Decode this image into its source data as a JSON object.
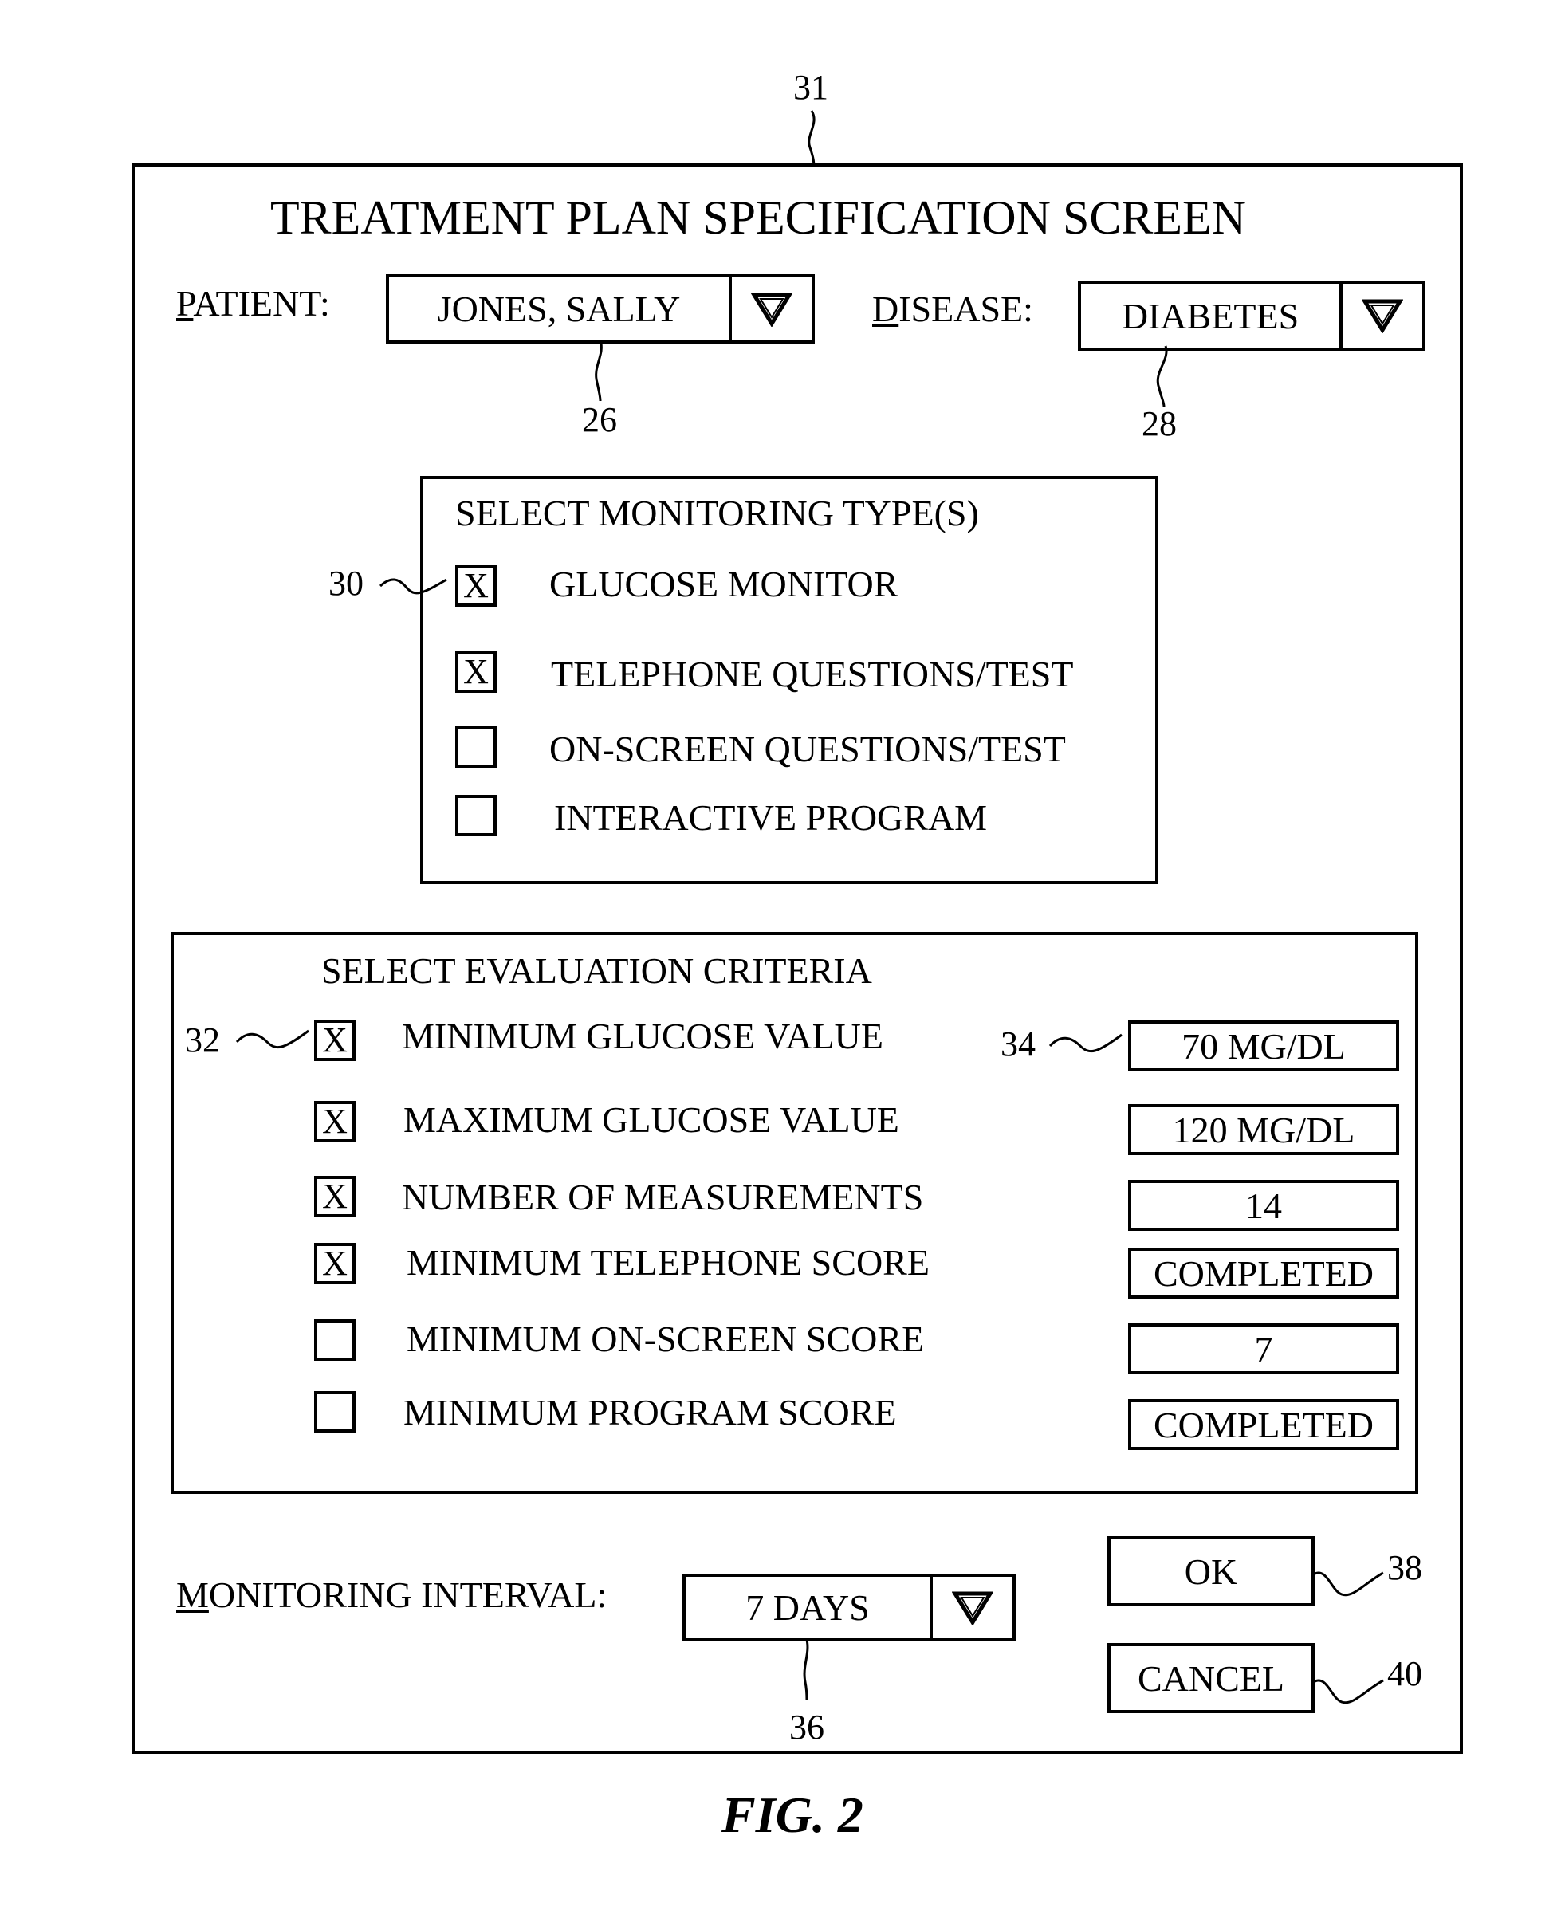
{
  "figure": {
    "caption": "FIG. 2",
    "reference_numerals": {
      "screen": "31",
      "patient_combo": "26",
      "disease_combo": "28",
      "monitoring_checkbox": "30",
      "criteria_checkbox": "32",
      "criteria_value_field": "34",
      "interval_combo": "36",
      "ok_button": "38",
      "cancel_button": "40"
    }
  },
  "screen": {
    "title": "TREATMENT PLAN SPECIFICATION SCREEN",
    "patient": {
      "label_accel": "P",
      "label_rest": "ATIENT:",
      "value": "JONES, SALLY",
      "dropdown_icon": "triangle-down-icon"
    },
    "disease": {
      "label_accel": "D",
      "label_rest": "ISEASE:",
      "value": "DIABETES",
      "dropdown_icon": "triangle-down-icon"
    },
    "monitoring_types": {
      "title": "SELECT MONITORING TYPE(S)",
      "items": [
        {
          "label": "GLUCOSE MONITOR",
          "checked": true,
          "mark": "X"
        },
        {
          "label": "TELEPHONE QUESTIONS/TEST",
          "checked": true,
          "mark": "X"
        },
        {
          "label": "ON-SCREEN QUESTIONS/TEST",
          "checked": false,
          "mark": ""
        },
        {
          "label": "INTERACTIVE PROGRAM",
          "checked": false,
          "mark": ""
        }
      ]
    },
    "evaluation_criteria": {
      "title": "SELECT EVALUATION CRITERIA",
      "items": [
        {
          "label": "MINIMUM GLUCOSE VALUE",
          "checked": true,
          "mark": "X",
          "value": "70 MG/DL"
        },
        {
          "label": "MAXIMUM GLUCOSE VALUE",
          "checked": true,
          "mark": "X",
          "value": "120 MG/DL"
        },
        {
          "label": "NUMBER OF MEASUREMENTS",
          "checked": true,
          "mark": "X",
          "value": "14"
        },
        {
          "label": "MINIMUM TELEPHONE SCORE",
          "checked": true,
          "mark": "X",
          "value": "COMPLETED"
        },
        {
          "label": "MINIMUM ON-SCREEN SCORE",
          "checked": false,
          "mark": "",
          "value": "7"
        },
        {
          "label": "MINIMUM PROGRAM SCORE",
          "checked": false,
          "mark": "",
          "value": "COMPLETED"
        }
      ]
    },
    "monitoring_interval": {
      "label_accel": "M",
      "label_rest": "ONITORING INTERVAL:",
      "value": "7 DAYS",
      "dropdown_icon": "triangle-down-icon"
    },
    "buttons": {
      "ok": "OK",
      "cancel": "CANCEL"
    }
  }
}
